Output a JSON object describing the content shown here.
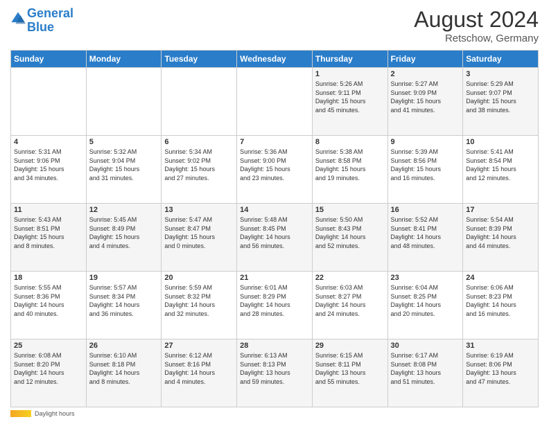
{
  "header": {
    "logo_general": "General",
    "logo_blue": "Blue",
    "month_year": "August 2024",
    "location": "Retschow, Germany"
  },
  "days_of_week": [
    "Sunday",
    "Monday",
    "Tuesday",
    "Wednesday",
    "Thursday",
    "Friday",
    "Saturday"
  ],
  "footer": {
    "daylight_label": "Daylight hours"
  },
  "weeks": [
    [
      {
        "date": "",
        "info": ""
      },
      {
        "date": "",
        "info": ""
      },
      {
        "date": "",
        "info": ""
      },
      {
        "date": "",
        "info": ""
      },
      {
        "date": "1",
        "info": "Sunrise: 5:26 AM\nSunset: 9:11 PM\nDaylight: 15 hours\nand 45 minutes."
      },
      {
        "date": "2",
        "info": "Sunrise: 5:27 AM\nSunset: 9:09 PM\nDaylight: 15 hours\nand 41 minutes."
      },
      {
        "date": "3",
        "info": "Sunrise: 5:29 AM\nSunset: 9:07 PM\nDaylight: 15 hours\nand 38 minutes."
      }
    ],
    [
      {
        "date": "4",
        "info": "Sunrise: 5:31 AM\nSunset: 9:06 PM\nDaylight: 15 hours\nand 34 minutes."
      },
      {
        "date": "5",
        "info": "Sunrise: 5:32 AM\nSunset: 9:04 PM\nDaylight: 15 hours\nand 31 minutes."
      },
      {
        "date": "6",
        "info": "Sunrise: 5:34 AM\nSunset: 9:02 PM\nDaylight: 15 hours\nand 27 minutes."
      },
      {
        "date": "7",
        "info": "Sunrise: 5:36 AM\nSunset: 9:00 PM\nDaylight: 15 hours\nand 23 minutes."
      },
      {
        "date": "8",
        "info": "Sunrise: 5:38 AM\nSunset: 8:58 PM\nDaylight: 15 hours\nand 19 minutes."
      },
      {
        "date": "9",
        "info": "Sunrise: 5:39 AM\nSunset: 8:56 PM\nDaylight: 15 hours\nand 16 minutes."
      },
      {
        "date": "10",
        "info": "Sunrise: 5:41 AM\nSunset: 8:54 PM\nDaylight: 15 hours\nand 12 minutes."
      }
    ],
    [
      {
        "date": "11",
        "info": "Sunrise: 5:43 AM\nSunset: 8:51 PM\nDaylight: 15 hours\nand 8 minutes."
      },
      {
        "date": "12",
        "info": "Sunrise: 5:45 AM\nSunset: 8:49 PM\nDaylight: 15 hours\nand 4 minutes."
      },
      {
        "date": "13",
        "info": "Sunrise: 5:47 AM\nSunset: 8:47 PM\nDaylight: 15 hours\nand 0 minutes."
      },
      {
        "date": "14",
        "info": "Sunrise: 5:48 AM\nSunset: 8:45 PM\nDaylight: 14 hours\nand 56 minutes."
      },
      {
        "date": "15",
        "info": "Sunrise: 5:50 AM\nSunset: 8:43 PM\nDaylight: 14 hours\nand 52 minutes."
      },
      {
        "date": "16",
        "info": "Sunrise: 5:52 AM\nSunset: 8:41 PM\nDaylight: 14 hours\nand 48 minutes."
      },
      {
        "date": "17",
        "info": "Sunrise: 5:54 AM\nSunset: 8:39 PM\nDaylight: 14 hours\nand 44 minutes."
      }
    ],
    [
      {
        "date": "18",
        "info": "Sunrise: 5:55 AM\nSunset: 8:36 PM\nDaylight: 14 hours\nand 40 minutes."
      },
      {
        "date": "19",
        "info": "Sunrise: 5:57 AM\nSunset: 8:34 PM\nDaylight: 14 hours\nand 36 minutes."
      },
      {
        "date": "20",
        "info": "Sunrise: 5:59 AM\nSunset: 8:32 PM\nDaylight: 14 hours\nand 32 minutes."
      },
      {
        "date": "21",
        "info": "Sunrise: 6:01 AM\nSunset: 8:29 PM\nDaylight: 14 hours\nand 28 minutes."
      },
      {
        "date": "22",
        "info": "Sunrise: 6:03 AM\nSunset: 8:27 PM\nDaylight: 14 hours\nand 24 minutes."
      },
      {
        "date": "23",
        "info": "Sunrise: 6:04 AM\nSunset: 8:25 PM\nDaylight: 14 hours\nand 20 minutes."
      },
      {
        "date": "24",
        "info": "Sunrise: 6:06 AM\nSunset: 8:23 PM\nDaylight: 14 hours\nand 16 minutes."
      }
    ],
    [
      {
        "date": "25",
        "info": "Sunrise: 6:08 AM\nSunset: 8:20 PM\nDaylight: 14 hours\nand 12 minutes."
      },
      {
        "date": "26",
        "info": "Sunrise: 6:10 AM\nSunset: 8:18 PM\nDaylight: 14 hours\nand 8 minutes."
      },
      {
        "date": "27",
        "info": "Sunrise: 6:12 AM\nSunset: 8:16 PM\nDaylight: 14 hours\nand 4 minutes."
      },
      {
        "date": "28",
        "info": "Sunrise: 6:13 AM\nSunset: 8:13 PM\nDaylight: 13 hours\nand 59 minutes."
      },
      {
        "date": "29",
        "info": "Sunrise: 6:15 AM\nSunset: 8:11 PM\nDaylight: 13 hours\nand 55 minutes."
      },
      {
        "date": "30",
        "info": "Sunrise: 6:17 AM\nSunset: 8:08 PM\nDaylight: 13 hours\nand 51 minutes."
      },
      {
        "date": "31",
        "info": "Sunrise: 6:19 AM\nSunset: 8:06 PM\nDaylight: 13 hours\nand 47 minutes."
      }
    ]
  ]
}
